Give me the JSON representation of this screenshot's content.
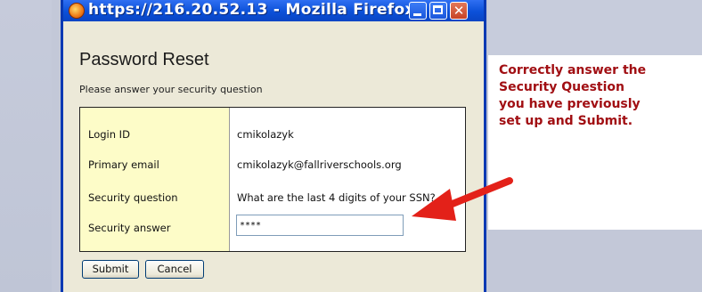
{
  "window": {
    "title": "https://216.20.52.13 - Mozilla Firefox",
    "close_glyph": "✕"
  },
  "page": {
    "heading": "Password Reset",
    "subheading": "Please answer your security question"
  },
  "form": {
    "rows": [
      {
        "label": "Login ID",
        "value": "cmikolazyk"
      },
      {
        "label": "Primary email",
        "value": "cmikolazyk@fallriverschools.org"
      },
      {
        "label": "Security question",
        "value": "What are the last 4 digits of your SSN?"
      },
      {
        "label": "Security answer",
        "value": "****"
      }
    ],
    "submit_label": "Submit",
    "cancel_label": "Cancel"
  },
  "callout": {
    "lines": [
      "Correctly answer the",
      "Security Question",
      "you have previously",
      "set up and Submit."
    ],
    "color": "#a10f13"
  },
  "colors": {
    "titlebar": "#0b50d8",
    "label_column": "#fdfcc8",
    "arrow": "#e32119"
  }
}
